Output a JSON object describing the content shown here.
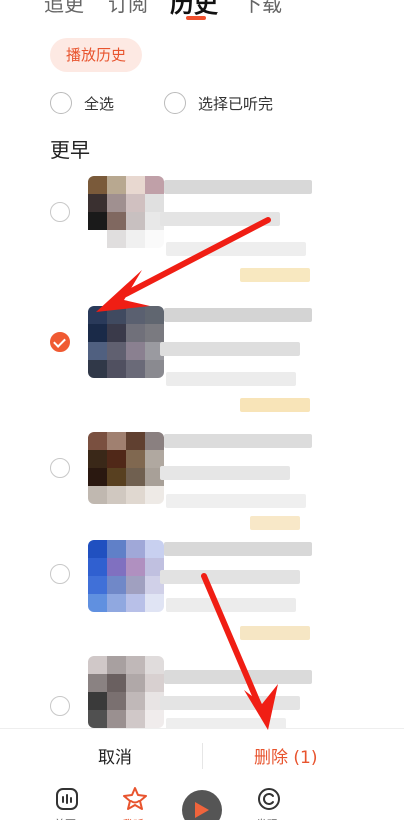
{
  "tabs": [
    {
      "label": "追更"
    },
    {
      "label": "订阅"
    },
    {
      "label": "历史"
    },
    {
      "label": "下载"
    }
  ],
  "more_label": "···",
  "chip_label": "播放历史",
  "select_all_label": "全选",
  "select_listened_label": "选择已听完",
  "section_title": "更早",
  "items": [
    {
      "checked": false
    },
    {
      "checked": true
    },
    {
      "checked": false
    },
    {
      "checked": false
    },
    {
      "checked": false
    }
  ],
  "actions": {
    "cancel_label": "取消",
    "delete_label": "删除 (1)"
  },
  "nav": {
    "home_label": "首页",
    "mine_label": "我听",
    "discover_label": "发现"
  },
  "colors": {
    "accent": "#e8542e",
    "chip_bg": "#fde9e3",
    "arrow": "#f01e14"
  }
}
